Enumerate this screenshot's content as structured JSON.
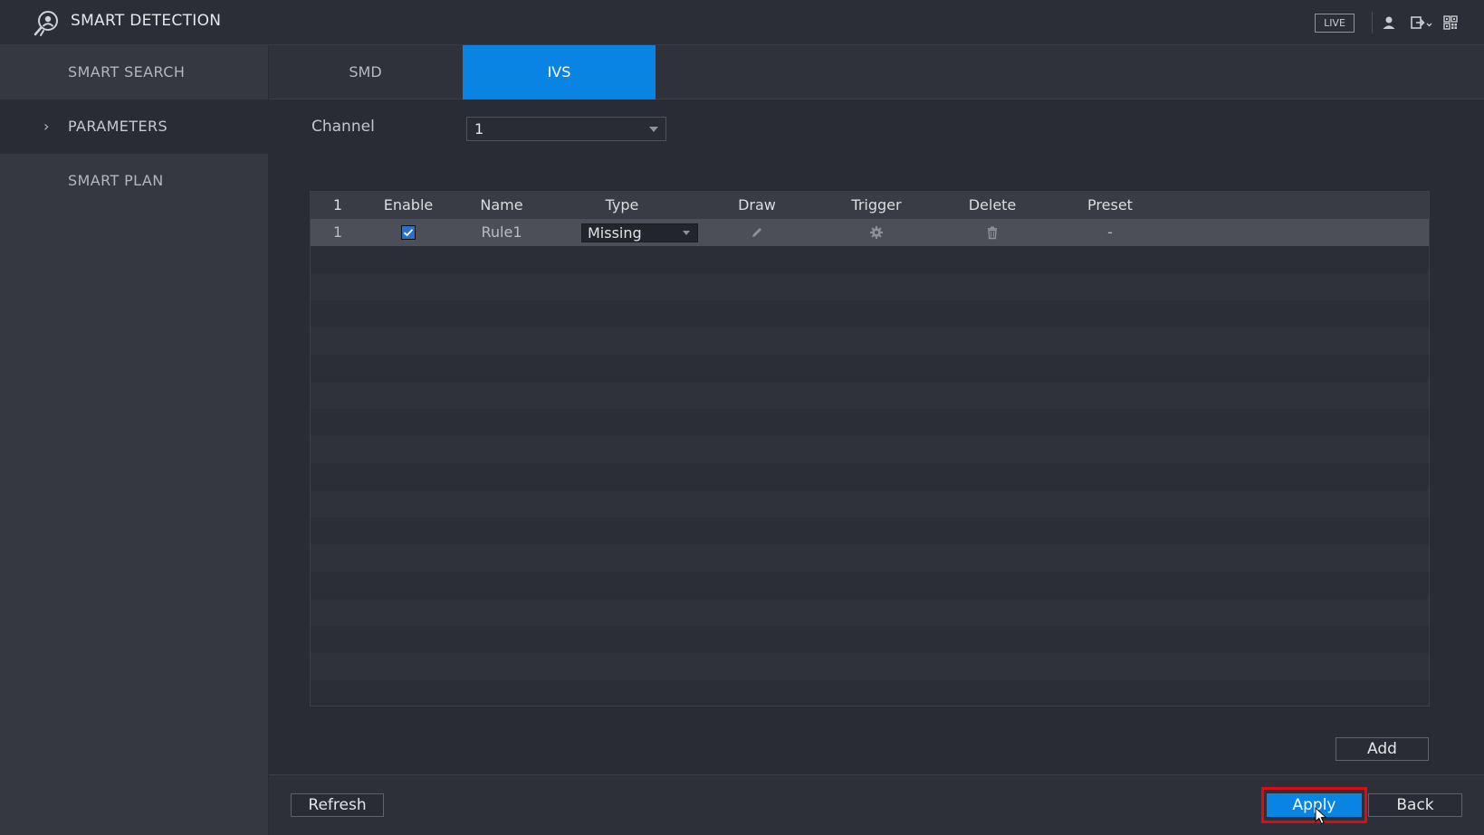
{
  "app": {
    "title": "SMART DETECTION"
  },
  "topbar": {
    "live_label": "LIVE"
  },
  "icons": {
    "app": "smart-detection-icon",
    "user": "user-icon",
    "logout": "logout-icon",
    "qr": "qr-code-icon",
    "draw": "pencil-icon",
    "trigger": "gear-icon",
    "delete": "trash-icon",
    "cursor": "mouse-cursor-icon"
  },
  "sidebar": {
    "items": [
      {
        "label": "SMART SEARCH"
      },
      {
        "label": "PARAMETERS",
        "chevron": "›"
      },
      {
        "label": "SMART PLAN"
      }
    ]
  },
  "tabs": [
    {
      "label": "SMD"
    },
    {
      "label": "IVS"
    }
  ],
  "channel": {
    "label": "Channel",
    "value": "1"
  },
  "table": {
    "headers": [
      "1",
      "Enable",
      "Name",
      "Type",
      "Draw",
      "Trigger",
      "Delete",
      "Preset"
    ],
    "rows": [
      {
        "index": "1",
        "enabled": true,
        "name": "Rule1",
        "type": "Missing",
        "preset": "-"
      }
    ]
  },
  "buttons": {
    "add": "Add",
    "refresh": "Refresh",
    "apply": "Apply",
    "back": "Back"
  },
  "colors": {
    "accent": "#0a84e3",
    "highlight": "#e00914",
    "sidebar_bg": "#353741",
    "main_bg": "#2a2c35"
  }
}
